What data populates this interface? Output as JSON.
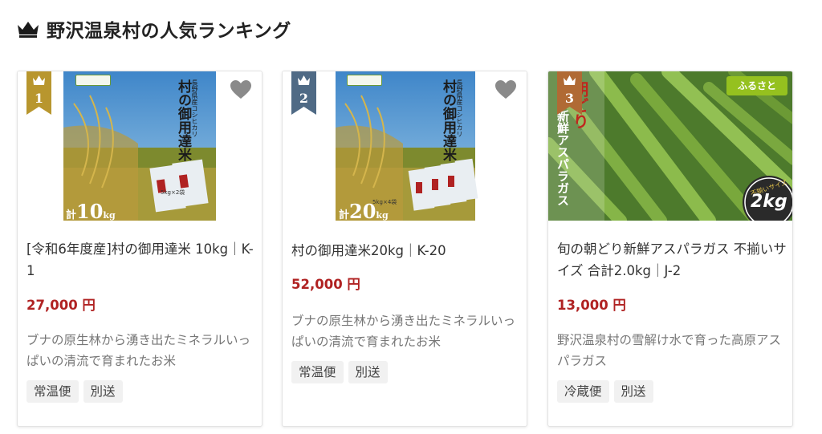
{
  "section": {
    "title": "野沢温泉村の人気ランキング",
    "icon": "crown-icon"
  },
  "colors": {
    "price": "#b02222",
    "rank1": "#b8962e",
    "rank2": "#4f6a85",
    "rank3": "#b06a34",
    "favorite": "#8a8a8a"
  },
  "products": [
    {
      "rank": "1",
      "image_text": {
        "kanji": "村の御用達米",
        "vertical_small": "長野県産コシヒカリ",
        "total": "計",
        "amount": "10",
        "unit": "kg",
        "bag_label": "5kg×2袋"
      },
      "title": "[令和6年度産]村の御用達米 10kg｜K-1",
      "price": "27,000 円",
      "description": "ブナの原生林から湧き出たミネラルいっぱいの清流で育まれたお米",
      "tags": [
        "常温便",
        "別送"
      ]
    },
    {
      "rank": "2",
      "image_text": {
        "kanji": "村の御用達米",
        "vertical_small": "長野県産コシヒカリ",
        "total": "計",
        "amount": "20",
        "unit": "kg",
        "bag_label": "5kg×4袋"
      },
      "title": "村の御用達米20kg｜K-20",
      "price": "52,000 円",
      "description": "ブナの原生林から湧き出たミネラルいっぱいの清流で育まれたお米",
      "tags": [
        "常温便",
        "別送"
      ]
    },
    {
      "rank": "3",
      "image_text": {
        "line1": "朝どり",
        "line2": "新鮮アスパラガス",
        "badge_top": "不揃いサイズ",
        "badge_amount": "2kg",
        "logo": "ふるさと"
      },
      "title": "旬の朝どり新鮮アスパラガス 不揃いサイズ 合計2.0kg｜J-2",
      "price": "13,000 円",
      "description": "野沢温泉村の雪解け水で育った高原アスパラガス",
      "tags": [
        "冷蔵便",
        "別送"
      ]
    }
  ]
}
